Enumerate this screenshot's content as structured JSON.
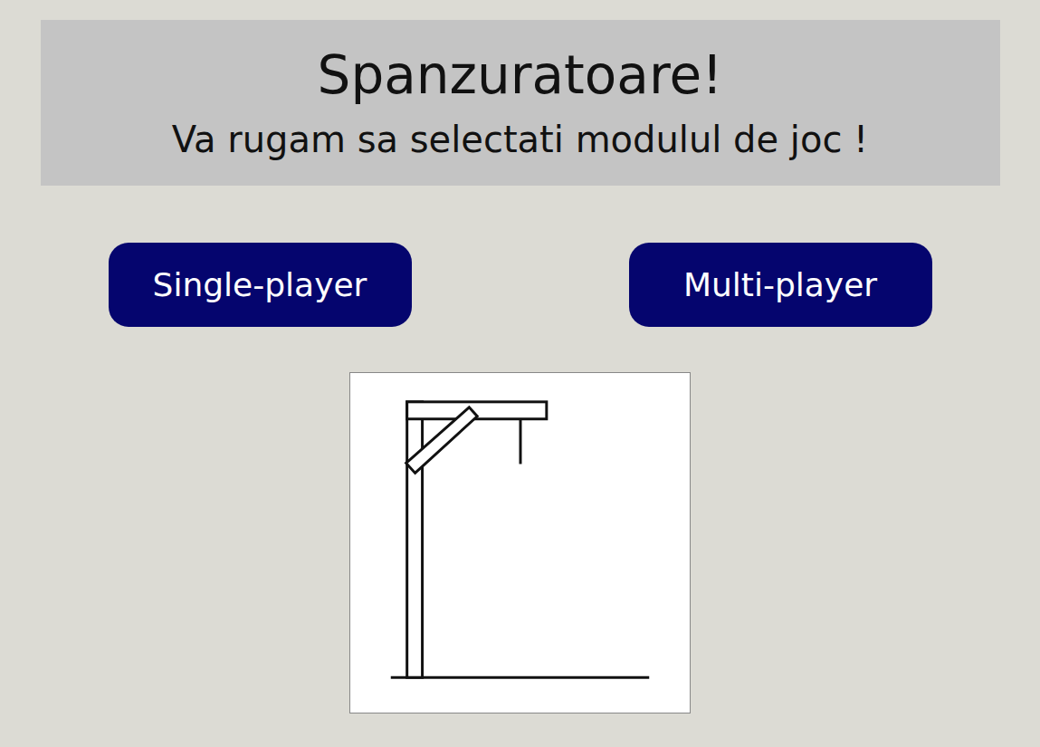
{
  "header": {
    "title": "Spanzuratoare!",
    "subtitle": "Va rugam sa selectati modulul de joc !"
  },
  "mode_buttons": [
    {
      "label": "Single-player"
    },
    {
      "label": "Multi-player"
    }
  ],
  "hangman": {
    "mistakes": 0
  }
}
